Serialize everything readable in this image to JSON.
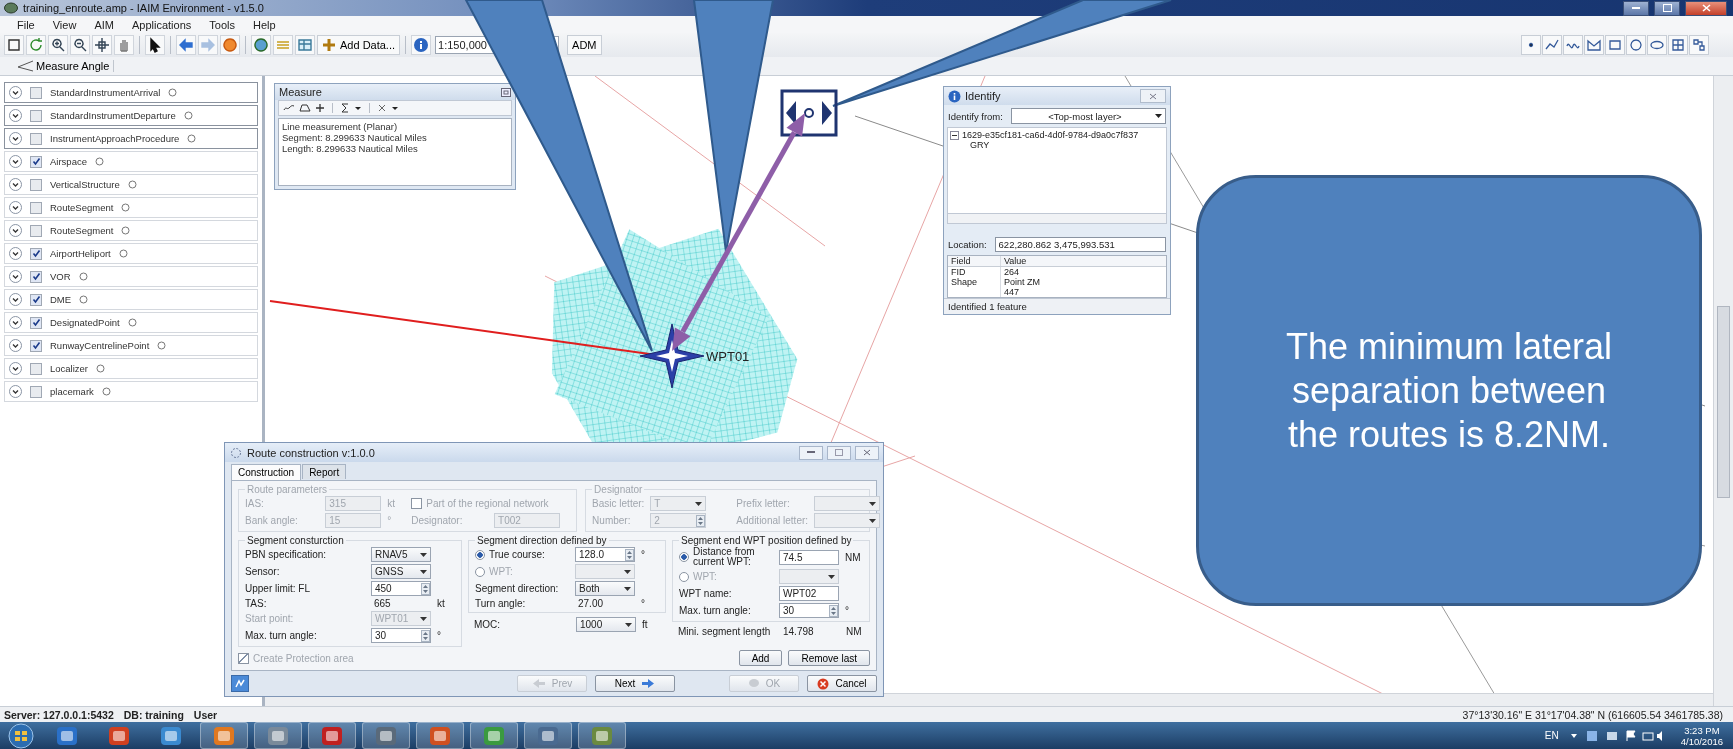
{
  "window": {
    "title": "training_enroute.amp - IAIM Environment - v1.5.0"
  },
  "menu": [
    "File",
    "View",
    "AIM",
    "Applications",
    "Tools",
    "Help"
  ],
  "toolbar": {
    "add_data": "Add Data...",
    "scale": "1:150,000",
    "adm": "ADM"
  },
  "measure_angle": "Measure Angle",
  "layers": [
    {
      "label": "StandardInstrumentArrival",
      "checked": false
    },
    {
      "label": "StandardInstrumentDeparture",
      "checked": false
    },
    {
      "label": "InstrumentApproachProcedure",
      "checked": false
    },
    {
      "label": "Airspace",
      "checked": true
    },
    {
      "label": "VerticalStructure",
      "checked": false
    },
    {
      "label": "RouteSegment",
      "checked": false
    },
    {
      "label": "RouteSegment",
      "checked": false
    },
    {
      "label": "AirportHeliport",
      "checked": true
    },
    {
      "label": "VOR",
      "checked": true
    },
    {
      "label": "DME",
      "checked": true
    },
    {
      "label": "DesignatedPoint",
      "checked": true
    },
    {
      "label": "RunwayCentrelinePoint",
      "checked": true
    },
    {
      "label": "Localizer",
      "checked": false
    },
    {
      "label": "placemark",
      "checked": false
    }
  ],
  "measure": {
    "title": "Measure",
    "lines": [
      "Line measurement (Planar)",
      "Segment: 8.299633 Nautical Miles",
      "Length: 8.299633 Nautical Miles"
    ]
  },
  "identify": {
    "title": "Identify",
    "from_label": "Identify from:",
    "from_value": "<Top-most layer>",
    "tree": [
      {
        "label": "1629-e35cf181-ca6d-4d0f-9784-d9a0c7f837",
        "expanded": true,
        "children": [
          {
            "label": "GRY"
          }
        ]
      }
    ],
    "location_label": "Location:",
    "location_value": "622,280.862  3,475,993.531",
    "columns": [
      "Field",
      "Value"
    ],
    "rows": [
      {
        "field": "FID",
        "value": "264"
      },
      {
        "field": "Shape",
        "value": "Point ZM"
      },
      {
        "value": "447"
      }
    ],
    "status": "Identified 1 feature"
  },
  "map": {
    "waypoint_label": "WPT01"
  },
  "callout": {
    "text": "The minimum lateral separation between the routes is 8.2NM."
  },
  "route_dialog": {
    "title": "Route construction v:1.0.0",
    "tabs": [
      {
        "label": "Construction",
        "selected": true
      },
      {
        "label": "Report",
        "selected": false
      }
    ],
    "route_parameters": {
      "legend": "Route parameters",
      "disabled": true,
      "fields": [
        {
          "kind": "text",
          "label": "IAS:",
          "value": "315",
          "unit": "kt"
        },
        {
          "kind": "checkbox",
          "label": "Part of the regional network",
          "checked": false
        },
        {
          "kind": "text",
          "label": "Bank angle:",
          "value": "15",
          "unit": "°"
        },
        {
          "kind": "text",
          "label": "Designator:",
          "value": "T002"
        }
      ]
    },
    "designator": {
      "legend": "Designator",
      "disabled": true,
      "fields": [
        {
          "kind": "select",
          "label": "Basic letter:",
          "value": "T"
        },
        {
          "kind": "select",
          "label": "Prefix letter:"
        },
        {
          "kind": "spin",
          "label": "Number:",
          "value": "2"
        },
        {
          "kind": "select",
          "label": "Additional letter:"
        }
      ]
    },
    "segment_construction": {
      "legend": "Segment consturction",
      "fields": [
        {
          "kind": "select",
          "label": "PBN specification:",
          "value": "RNAV5",
          "disabled": false
        },
        {
          "kind": "select",
          "label": "Sensor:",
          "value": "GNSS",
          "disabled": false
        },
        {
          "kind": "spin",
          "label": "Upper limit: FL",
          "value": "450",
          "disabled": false
        },
        {
          "kind": "readonly",
          "label": "TAS:",
          "value": "665",
          "unit": "kt",
          "disabled": false
        },
        {
          "kind": "select",
          "label": "Start point:",
          "value": "WPT01",
          "disabled": true
        },
        {
          "kind": "spin",
          "label": "Max. turn angle:",
          "value": "30",
          "unit": "°",
          "disabled": false
        }
      ]
    },
    "segment_direction": {
      "legend": "Segment direction defined by",
      "fields": [
        {
          "kind": "spin",
          "label": "True course:",
          "selected": true,
          "value": "128.0",
          "unit": "°",
          "disabled": false
        },
        {
          "kind": "select",
          "label": "WPT:",
          "selected": false,
          "disabled": true
        },
        {
          "kind": "select",
          "label": "Segment direction:",
          "value": "Both",
          "disabled": false
        },
        {
          "kind": "readonly",
          "label": "Turn angle:",
          "value": "27.00",
          "unit": "°",
          "disabled": false
        }
      ]
    },
    "segment_end": {
      "legend": "Segment end WPT position defined by",
      "fields": [
        {
          "kind": "text",
          "label": "Distance from current WPT:",
          "selected": true,
          "value": "74.5",
          "unit": "NM",
          "disabled": false
        },
        {
          "kind": "select",
          "label": "WPT:",
          "selected": false,
          "disabled": true
        },
        {
          "kind": "text",
          "label": "WPT name:",
          "value": "WPT02",
          "disabled": false
        },
        {
          "kind": "spin",
          "label": "Max. turn angle:",
          "value": "30",
          "unit": "°",
          "disabled": false
        }
      ]
    },
    "moc": {
      "kind": "select",
      "label": "MOC:",
      "value": "1000",
      "unit": "ft",
      "disabled": false
    },
    "min_segment_length": {
      "kind": "readonly",
      "label": "Mini. segment length",
      "value": "14.798",
      "unit": "NM",
      "disabled": false
    },
    "protection": {
      "label": "Create Protection area",
      "checked": true,
      "disabled": true
    },
    "actions": [
      "Add",
      "Remove last"
    ],
    "nav_buttons": [
      {
        "label": "Prev",
        "kind": "prev",
        "disabled": true
      },
      {
        "label": "Next",
        "kind": "next",
        "disabled": false
      },
      {
        "label": "OK",
        "kind": "ok",
        "disabled": true
      },
      {
        "label": "Cancel",
        "kind": "cancel",
        "disabled": false
      }
    ]
  },
  "status_bar": {
    "server": "Server: 127.0.0.1:5432",
    "db": "DB: training",
    "user": "User",
    "coordinates": "37°13'30.16\" E  31°17'04.38\" N  (616605.54  3461785.38)"
  },
  "taskbar": {
    "language": "EN",
    "time": "3:23 PM",
    "date": "4/10/2016"
  }
}
